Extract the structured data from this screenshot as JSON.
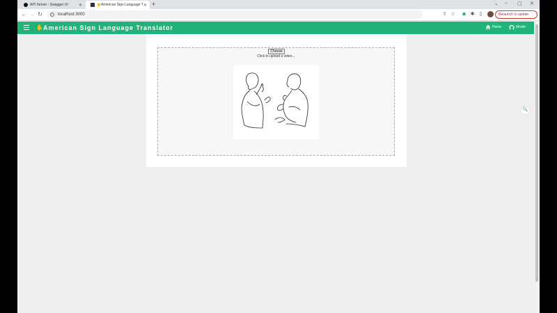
{
  "browser": {
    "tabs": [
      {
        "title": "API Server - Swagger UI",
        "active": false
      },
      {
        "title": "🤟American Sign Language T",
        "active": true
      }
    ],
    "url": "localhost:3000",
    "relaunch_label": "Relaunch to update"
  },
  "app": {
    "title": "American Sign Language Translator",
    "nav": [
      {
        "label": "Home",
        "icon": "home-icon"
      },
      {
        "label": "Model",
        "icon": "model-icon"
      }
    ]
  },
  "upload": {
    "choose_label": "Choose",
    "hint": "Click to upload a video..."
  },
  "colors": {
    "appbar": "#21b37a",
    "background": "#efefef"
  }
}
